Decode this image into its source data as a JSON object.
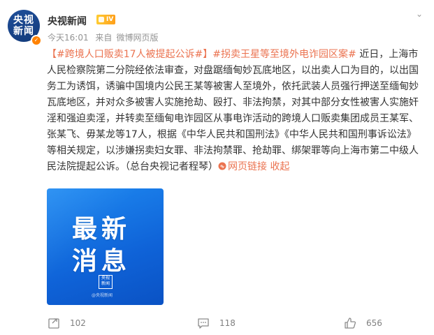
{
  "post": {
    "author": "央视新闻",
    "avatar_text_line1": "央视",
    "avatar_text_line2": "新闻",
    "vip_label": "IV",
    "time": "今天16:01",
    "source_prefix": "来自",
    "source": "微博网页版",
    "topic1": "【#跨境人口贩卖17人被提起公诉#】",
    "topic2": "#拐卖王星等至境外电诈园区案#",
    "body": " 近日，上海市人民检察院第二分院经依法审查，对盘踞缅甸妙瓦底地区，以出卖人口为目的，以出国务工为诱饵，诱骗中国境内公民王某等被害人至境外，依托武装人员强行押送至缅甸妙瓦底地区，并对众多被害人实施抢劫、殴打、非法拘禁，对其中部分女性被害人实施奸淫和强迫卖淫，并转卖至缅甸电诈园区从事电诈活动的跨境人口贩卖集团成员王某军、张某飞、毋某龙等17人，根据《中华人民共和国刑法》《中华人民共和国刑事诉讼法》等相关规定，以涉嫌拐卖妇女罪、非法拘禁罪、抢劫罪、绑架罪等向上海市第二中级人民法院提起公诉。（总台央视记者程琴）",
    "link_text": "网页链接",
    "collapse_text": "收起",
    "image": {
      "title_line1": "最新",
      "title_line2": "消息",
      "logo_line1": "央视",
      "logo_line2": "新闻",
      "watermark": "@央视新闻"
    }
  },
  "actions": {
    "repost_count": "102",
    "comment_count": "118",
    "like_count": "656"
  },
  "colors": {
    "topic": "#eb7350",
    "image_blue": "#1f8bf2"
  }
}
